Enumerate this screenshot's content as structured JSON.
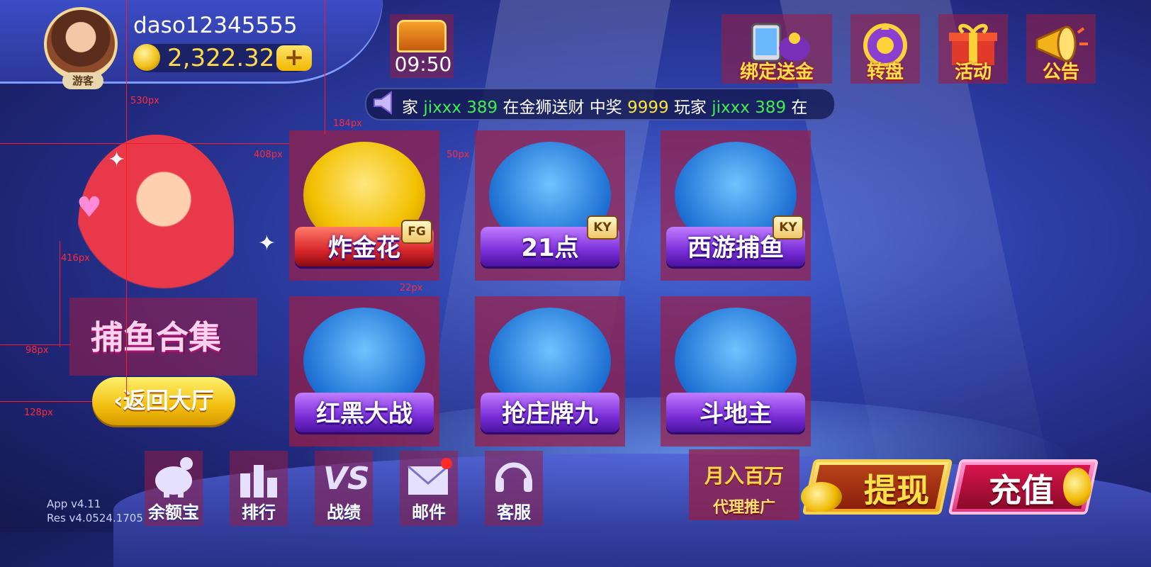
{
  "profile": {
    "username": "daso12345555",
    "guest_tag": "游客",
    "balance": "2,322.32",
    "add_label": "+"
  },
  "treasure": {
    "timer": "09:50"
  },
  "top_buttons": [
    {
      "label": "绑定送金",
      "icon": "phone-gift-icon"
    },
    {
      "label": "转盘",
      "icon": "wheel-icon"
    },
    {
      "label": "活动",
      "icon": "gift-box-icon"
    },
    {
      "label": "公告",
      "icon": "megaphone-icon"
    }
  ],
  "marquee": {
    "segments": [
      {
        "text": "家 ",
        "c": ""
      },
      {
        "text": "jixxx 389",
        "c": "g"
      },
      {
        "text": " 在金狮送财 中奖 ",
        "c": ""
      },
      {
        "text": "9999",
        "c": "y"
      },
      {
        "text": "    玩家 ",
        "c": ""
      },
      {
        "text": "jixxx 389",
        "c": "g"
      },
      {
        "text": " 在",
        "c": ""
      }
    ]
  },
  "promo": {
    "label": "捕鱼合集",
    "back_label": "返回大厅"
  },
  "games": [
    {
      "name": "炸金花",
      "badge": "FG"
    },
    {
      "name": "21点",
      "badge": "KY"
    },
    {
      "name": "西游捕鱼",
      "badge": "KY"
    },
    {
      "name": "红黑大战",
      "badge": ""
    },
    {
      "name": "抢庄牌九",
      "badge": ""
    },
    {
      "name": "斗地主",
      "badge": ""
    }
  ],
  "bottom_nav": [
    {
      "label": "余额宝",
      "icon": "piggy-bank-icon"
    },
    {
      "label": "排行",
      "icon": "ranking-icon"
    },
    {
      "label": "战绩",
      "icon": "vs-record-icon"
    },
    {
      "label": "邮件",
      "icon": "mail-icon"
    },
    {
      "label": "客服",
      "icon": "headset-icon"
    }
  ],
  "agent": {
    "top": "月入百万",
    "label": "代理推广"
  },
  "actions": {
    "withdraw": "提现",
    "recharge": "充值"
  },
  "version": {
    "app": "App  v4.11",
    "res": "Res  v4.0524.1705"
  },
  "guides": {
    "t1": "530px",
    "t2": "184px",
    "t3": "408px",
    "t4": "50px",
    "t5": "416px",
    "t6": "22px",
    "t7": "98px",
    "t8": "128px"
  },
  "colors": {
    "accent": "#ffd94a",
    "card_overlay": "#9b1e46",
    "background": "#2d3fa8"
  }
}
